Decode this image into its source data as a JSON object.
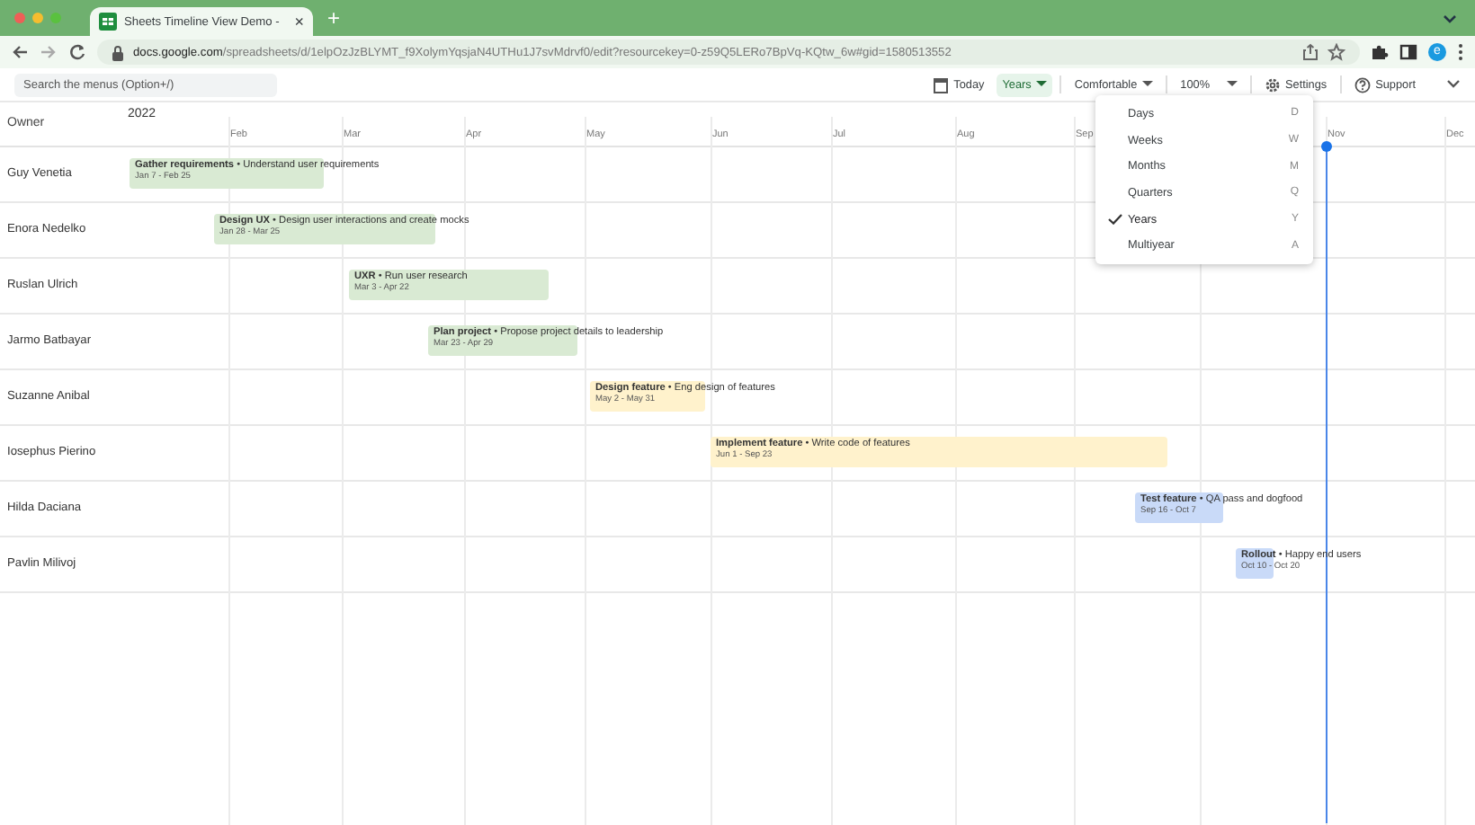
{
  "browser": {
    "tab_title": "Sheets Timeline View Demo - ",
    "tab_close": "×",
    "new_tab": "+",
    "url_host": "docs.google.com",
    "url_path": "/spreadsheets/d/1elpOzJzBLYMT_f9XolymYqsjaN4UTHu1J7svMdrvf0/edit?resourcekey=0-z59Q5LERo7BpVq-KQtw_6w#gid=1580513552",
    "profile": "e"
  },
  "toolbar": {
    "search_placeholder": "Search the menus (Option+/)",
    "today": "Today",
    "scale": "Years",
    "density": "Comfortable",
    "zoom": "100%",
    "settings": "Settings",
    "support": "Support"
  },
  "timeline": {
    "owner_header": "Owner",
    "year": "2022",
    "months": [
      "Feb",
      "Mar",
      "Apr",
      "May",
      "Jun",
      "Jul",
      "Aug",
      "Sep",
      "Nov",
      "Dec"
    ],
    "rows": [
      {
        "owner": "Guy Venetia",
        "title": "Gather requirements",
        "desc": "• Understand user requirements",
        "dates": "Jan 7 - Feb 25",
        "color": "#d9ead3"
      },
      {
        "owner": "Enora Nedelko",
        "title": "Design UX",
        "desc": "• Design user interactions and create mocks",
        "dates": "Jan 28 - Mar 25",
        "color": "#d9ead3"
      },
      {
        "owner": "Ruslan Ulrich",
        "title": "UXR",
        "desc": "• Run user research",
        "dates": "Mar 3 - Apr 22",
        "color": "#d9ead3"
      },
      {
        "owner": "Jarmo Batbayar",
        "title": "Plan project",
        "desc": "• Propose project details to leadership",
        "dates": "Mar 23 - Apr 29",
        "color": "#d9ead3"
      },
      {
        "owner": "Suzanne Anibal",
        "title": "Design feature",
        "desc": "• Eng design of features",
        "dates": "May 2 - May 31",
        "color": "#fff2cc"
      },
      {
        "owner": "Iosephus Pierino",
        "title": "Implement feature",
        "desc": "• Write code of features",
        "dates": "Jun 1 - Sep 23",
        "color": "#fff2cc"
      },
      {
        "owner": "Hilda Daciana",
        "title": "Test feature",
        "desc": "• QA pass and dogfood",
        "dates": "Sep 16 - Oct 7",
        "color": "#c9daf8"
      },
      {
        "owner": "Pavlin Milivoj",
        "title": "Rollout",
        "desc": "• Happy end users",
        "dates": "Oct 10 - Oct 20",
        "color": "#c9daf8"
      }
    ]
  },
  "scale_menu": [
    {
      "label": "Days",
      "key": "D",
      "selected": false
    },
    {
      "label": "Weeks",
      "key": "W",
      "selected": false
    },
    {
      "label": "Months",
      "key": "M",
      "selected": false
    },
    {
      "label": "Quarters",
      "key": "Q",
      "selected": false
    },
    {
      "label": "Years",
      "key": "Y",
      "selected": true
    },
    {
      "label": "Multiyear",
      "key": "A",
      "selected": false
    }
  ]
}
